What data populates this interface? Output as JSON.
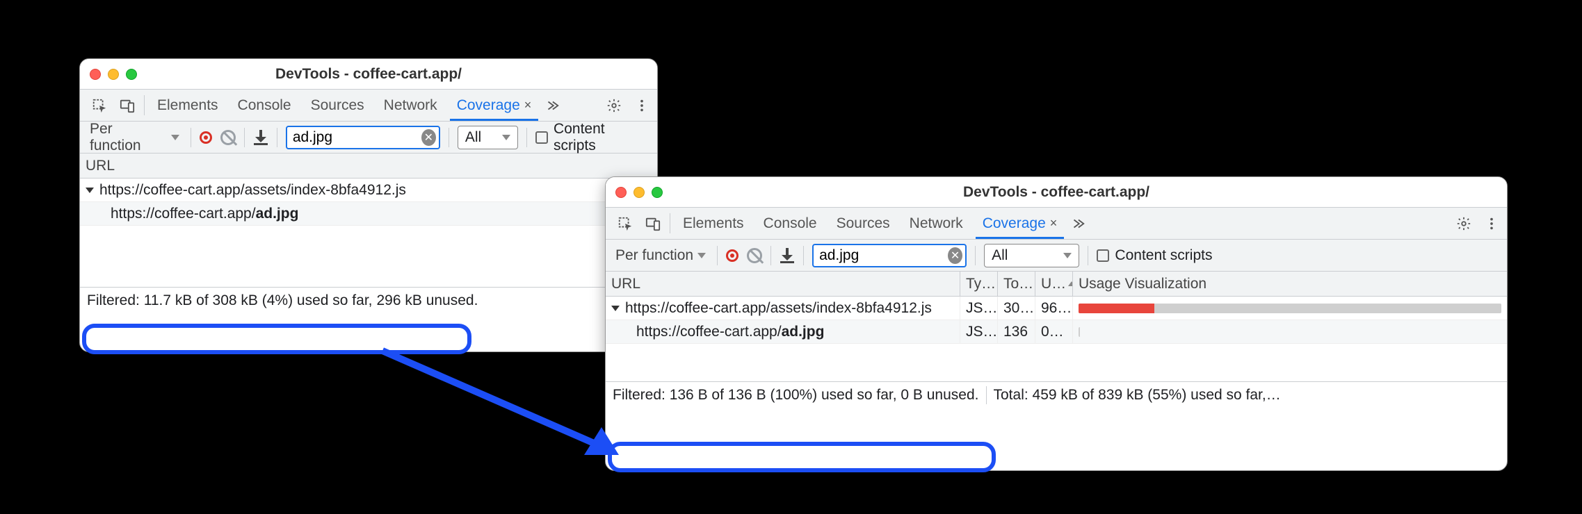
{
  "window_title": "DevTools - coffee-cart.app/",
  "tabs": {
    "elements": "Elements",
    "console": "Console",
    "sources": "Sources",
    "network": "Network",
    "coverage": "Coverage"
  },
  "toolbar": {
    "granularity": "Per function",
    "filter_value": "ad.jpg",
    "type_filter": "All",
    "content_scripts_label": "Content scripts"
  },
  "columns": {
    "url": "URL",
    "type": "Ty…",
    "total": "To…",
    "unused": "U…",
    "usage": "Usage Visualization"
  },
  "left": {
    "rows": [
      {
        "url_prefix": "https://coffee-cart.app/assets/index-8bfa4912.js",
        "url_bold": ""
      },
      {
        "url_prefix": "https://coffee-cart.app/",
        "url_bold": "ad.jpg"
      }
    ],
    "status_filtered": "Filtered: 11.7 kB of 308 kB (4%) used so far,",
    "status_rest": "296 kB unused."
  },
  "right": {
    "rows": [
      {
        "url_prefix": "https://coffee-cart.app/assets/index-8bfa4912.js",
        "url_bold": "",
        "type": "JS…",
        "total": "30…",
        "unused": "96…",
        "used_pct": 18
      },
      {
        "url_prefix": "https://coffee-cart.app/",
        "url_bold": "ad.jpg",
        "type": "JS…",
        "total": "136",
        "unused": "0…",
        "used_pct": 2
      }
    ],
    "status_filtered": "Filtered: 136 B of 136 B (100%) used so far, 0 B unused.",
    "status_total": "Total: 459 kB of 839 kB (55%) used so far,…"
  }
}
